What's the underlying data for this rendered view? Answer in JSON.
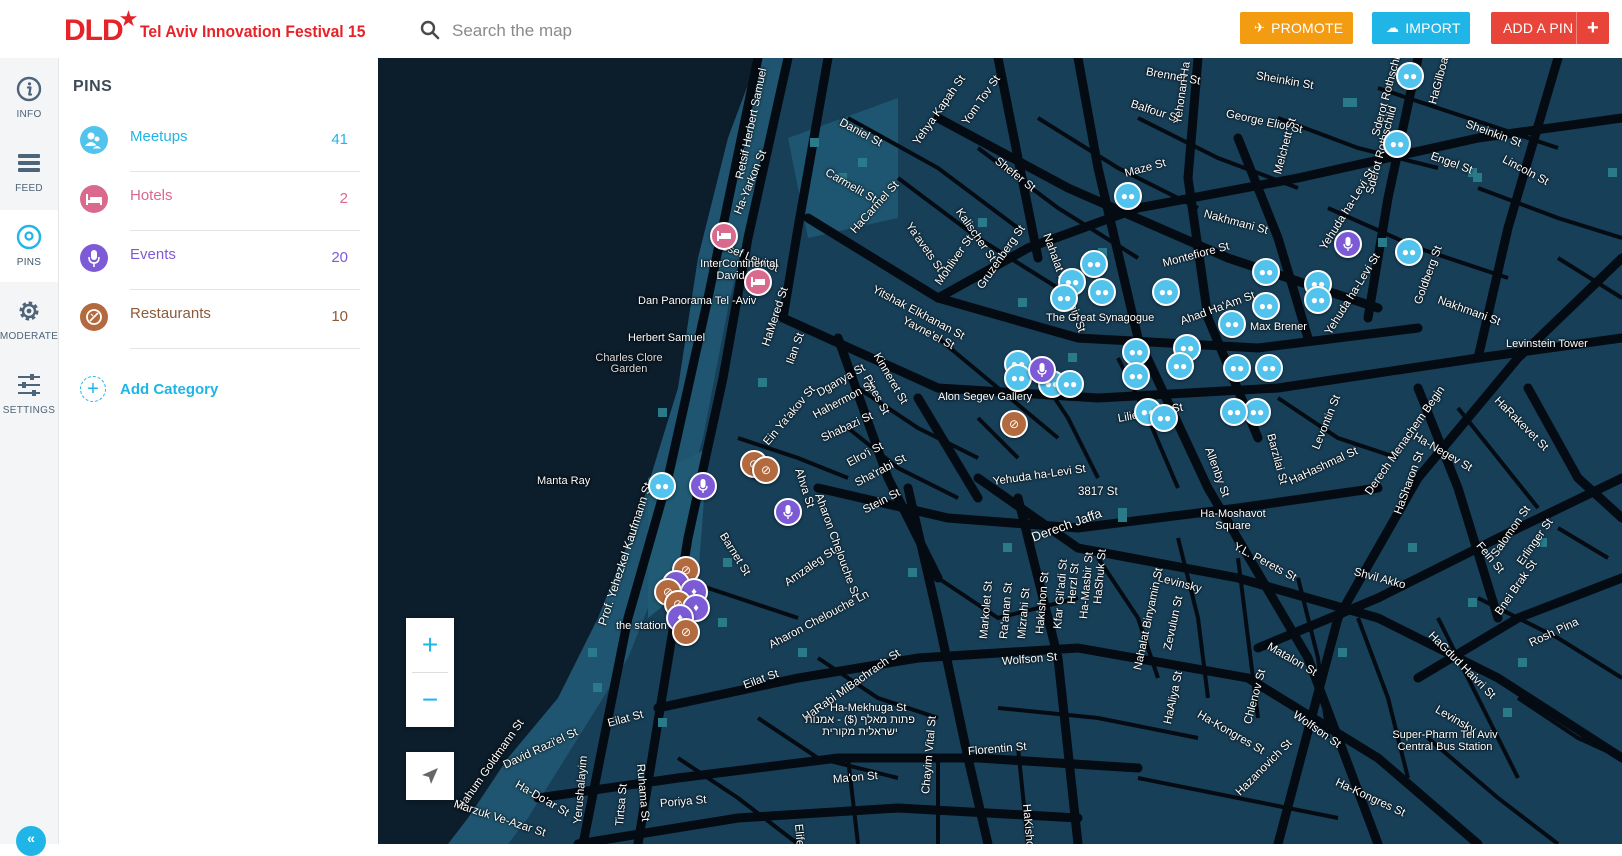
{
  "header": {
    "logo_main": "DLD",
    "logo_sub": "Tel Aviv Innovation Festival 15",
    "search_placeholder": "Search the map",
    "promote_label": "PROMOTE",
    "import_label": "IMPORT",
    "add_pin_label": "ADD A PIN",
    "add_pin_plus": "+"
  },
  "nav": {
    "items": [
      {
        "label": "INFO",
        "icon": "info-icon"
      },
      {
        "label": "FEED",
        "icon": "feed-icon"
      },
      {
        "label": "PINS",
        "icon": "pin-icon"
      },
      {
        "label": "MODERATE",
        "icon": "gear-icon"
      },
      {
        "label": "SETTINGS",
        "icon": "sliders-icon"
      }
    ],
    "active": "PINS",
    "collapse_glyph": "«"
  },
  "panel": {
    "title": "PINS",
    "categories": [
      {
        "name": "Meetups",
        "count": "41",
        "color": "#52c3ec",
        "icon": "people-icon"
      },
      {
        "name": "Hotels",
        "count": "2",
        "color": "#d9698d",
        "icon": "bed-icon"
      },
      {
        "name": "Events",
        "count": "20",
        "color": "#7d5bd6",
        "icon": "microphone-icon"
      },
      {
        "name": "Restaurants",
        "count": "10",
        "color": "#b36a3f",
        "icon": "food-icon"
      }
    ],
    "add_category": "Add Category",
    "add_category_plus": "+"
  },
  "map": {
    "zoom_in": "+",
    "zoom_out": "−",
    "streets": [
      "Brenner St",
      "Sheinkin St",
      "Balfour St",
      "George Eliot St",
      "Daniel St",
      "Yehya Kapah St",
      "Yom Tov St",
      "Retsif Herbert Samuel",
      "Ha-Yarkon St",
      "Carmelit St",
      "Shefer St",
      "Maze St",
      "Nakhmani St",
      "Sderot Rothschild",
      "Engel St",
      "Lincoln St",
      "HaCarmel St",
      "Kalischer St",
      "Ya'avets St",
      "Mohliver St",
      "Gruzenberg St",
      "Nahalat Binyamin St",
      "Montefiore St",
      "Yosef Levi St",
      "Yitshak Elkhanan St",
      "Yavne'el St",
      "Ahad Ha'Am St",
      "Max Brener",
      "Yehuda ha-Levi St",
      "Goldberg St",
      "Nakhmani St",
      "HaMered St",
      "Ilan St",
      "Kinneret St",
      "Dganya St",
      "Pines St",
      "Hahermon St",
      "Shabazi St",
      "Elro'i St",
      "Sha'rabi St",
      "Stein St",
      "Ein Ya'akov St",
      "Aharon Chelouche St",
      "Ahva St",
      "Lilienblum St",
      "Allenby St",
      "Barzilai St",
      "Levontin St",
      "HaHashmal St",
      "Derech Menachem Begin",
      "HaRakevet St",
      "Ha-Negev St",
      "3817 St",
      "Yehuda ha-Levi St",
      "Derech Jaffa",
      "Ha-Moshavot Square",
      "Prof. Yehezkel Kaufmann St",
      "Barnet St",
      "Amzaleg St",
      "Aharon Chelouche Ln",
      "Y.L. Perets St",
      "Shvil Akko",
      "Levinsky",
      "Herzl St",
      "HaShuk St",
      "Ha-Masbir St",
      "Kfar Gil'adi St",
      "Hakishon St",
      "Mizrahi St",
      "Ra'anan St",
      "Markolet St",
      "Nahalat Binyamin St",
      "Zevulun St",
      "Matalon St",
      "Chlenov St",
      "HaGdud Haivri St",
      "Rosh Pina",
      "Wolfson St",
      "Wolfson St",
      "Eilat St",
      "Eilat St",
      "HaRabi MiBachrach St",
      "Ha-Mekhuga St",
      "David Razi'el St",
      "Nahum Goldmann St",
      "Ha-Do'ar St",
      "Yerushalayim",
      "Tirtsa St",
      "Ruhama St",
      "Marzuk Ve-Azar St",
      "Poriya St",
      "Ma'on St",
      "Florentin St",
      "Chayim Vital St",
      "HaKishon St",
      "Elifelet St",
      "HaAliya St",
      "Ha-Kongres St",
      "Hazanovich St",
      "Ha-Kongres St",
      "Levinsky",
      "Salomon St",
      "Erlinger St",
      "Fein St",
      "Bnei Brak St",
      "HaSharon St",
      "Sderot Rothschild",
      "Yehuda ha-Levi St",
      "HaGilboa St",
      "Sheinkin St",
      "Melchett St",
      "Yehonan Ha"
    ],
    "places": [
      "InterContinental David Tel",
      "Dan Panorama Tel -Aviv",
      "Herbert Samuel",
      "Charles Clore Garden",
      "Manta Ray",
      "The Great Synagogue",
      "Alon Segev Gallery",
      "Levinstein Tower",
      "the station",
      "פתות מאלף ($) - אמנות ישראלית מקורית",
      "Super-Pharm Tel Aviv Central Bus Station"
    ]
  }
}
